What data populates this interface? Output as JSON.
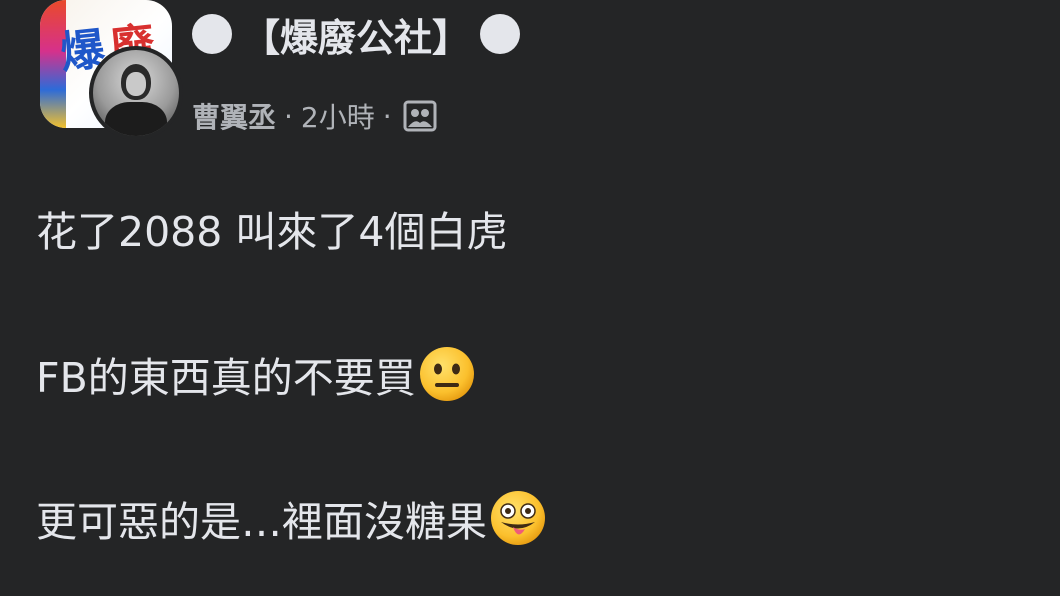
{
  "post": {
    "group_title": "【爆廢公社】",
    "author": "曹翼丞",
    "separator": "·",
    "time": "2小時",
    "audience_icon": "photo-audience-icon",
    "lines": [
      "花了2088 叫來了4個白虎",
      "FB的東西真的不要買",
      "更可惡的是…裡面沒糖果"
    ],
    "emojis": [
      "neutral-face-emoji",
      "zany-face-emoji"
    ]
  },
  "group_avatar": {
    "logo_text_1": "爆",
    "logo_text_2": "廢"
  },
  "colors": {
    "background": "#242526",
    "primary_text": "#e4e6eb",
    "secondary_text": "#b0b3b8"
  }
}
